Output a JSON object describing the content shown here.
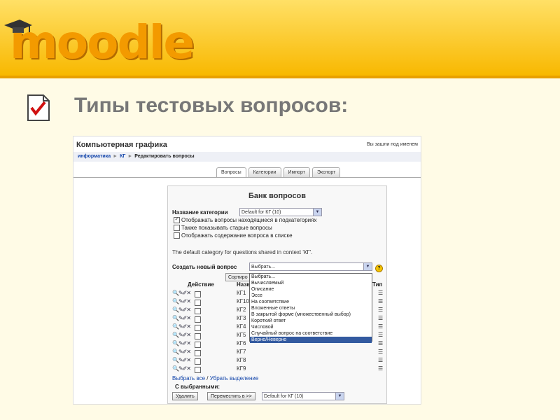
{
  "slide": {
    "logo": "moodle",
    "title": "Типы тестовых вопросов:"
  },
  "screenshot": {
    "course_title": "Компьютерная графика",
    "login_text": "Вы зашли под именем",
    "breadcrumbs": [
      "информатика",
      "КГ",
      "Редактировать вопросы"
    ],
    "breadcrumb_sep": "►",
    "tabs": [
      "Вопросы",
      "Категории",
      "Импорт",
      "Экспорт"
    ],
    "bank": {
      "title": "Банк вопросов",
      "category_label": "Название категории",
      "category_value": "Default for КГ (10)",
      "checkboxes": [
        {
          "label": "Отображать вопросы находящиеся в подкатегориях",
          "checked": true
        },
        {
          "label": "Также показывать старые вопросы",
          "checked": false
        },
        {
          "label": "Отображать содержание вопроса в списке",
          "checked": false
        }
      ],
      "info_text": "The default category for questions shared in context 'КГ'.",
      "create_label": "Создать новый вопрос",
      "create_value": "Выбрать...",
      "help_glyph": "?",
      "sort_label": "Сортиро",
      "col_action": "Действие",
      "col_name": "Назв",
      "col_type": "Тип",
      "rows": [
        "КГ1",
        "КГ10",
        "КГ2",
        "КГ3",
        "КГ4",
        "КГ5",
        "КГ6",
        "КГ7",
        "КГ8",
        "КГ9"
      ],
      "row_icons": "🔍✎✐✕",
      "type_icon": "☰",
      "select_all": "Выбрать все",
      "link_sep": " / ",
      "deselect": "Убрать выделение",
      "with_selected": "С выбранными:",
      "delete_button": "Удалить",
      "move_button": "Переместить в >>",
      "move_target": "Default for КГ (10)"
    },
    "dropdown_options": [
      "Выбрать...",
      "Вычисляемый",
      "Описание",
      "Эссе",
      "На соответствие",
      "Вложенные ответы",
      "В закрытой форме (множественный выбор)",
      "Короткий ответ",
      "Числовой",
      "Случайный вопрос на соответствие",
      "Верно/Неверно"
    ],
    "dropdown_highlighted": "Верно/Неверно"
  },
  "colors": {
    "banner": "#f8b800",
    "link": "#1144aa",
    "highlight": "#335aa0"
  }
}
